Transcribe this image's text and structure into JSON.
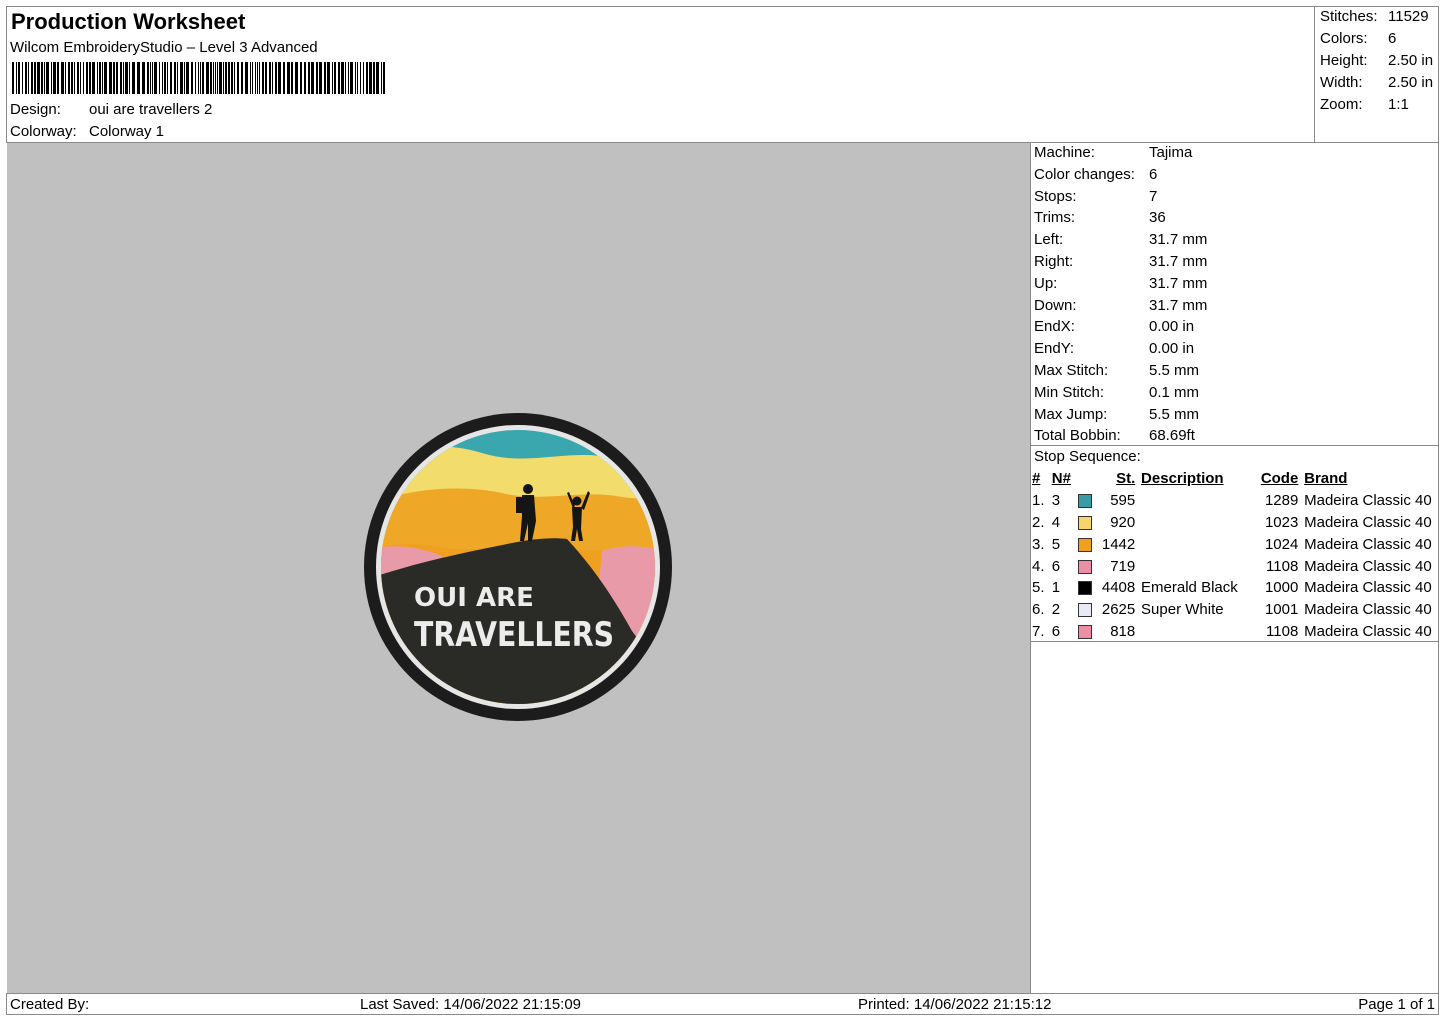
{
  "header": {
    "title": "Production Worksheet",
    "subtitle": "Wilcom EmbroideryStudio – Level 3 Advanced",
    "design_label": "Design:",
    "design_value": "oui are travellers 2",
    "colorway_label": "Colorway:",
    "colorway_value": "Colorway 1"
  },
  "summary": [
    {
      "label": "Stitches:",
      "value": "11529"
    },
    {
      "label": "Colors:",
      "value": "6"
    },
    {
      "label": "Height:",
      "value": "2.50 in"
    },
    {
      "label": "Width:",
      "value": "2.50 in"
    },
    {
      "label": "Zoom:",
      "value": "1:1"
    }
  ],
  "machine_info": [
    {
      "label": "Machine:",
      "value": "Tajima"
    },
    {
      "label": "Color changes:",
      "value": "6"
    },
    {
      "label": "Stops:",
      "value": "7"
    },
    {
      "label": "Trims:",
      "value": "36"
    },
    {
      "label": "Left:",
      "value": "31.7 mm"
    },
    {
      "label": "Right:",
      "value": "31.7 mm"
    },
    {
      "label": "Up:",
      "value": "31.7 mm"
    },
    {
      "label": "Down:",
      "value": "31.7 mm"
    },
    {
      "label": "EndX:",
      "value": "0.00 in"
    },
    {
      "label": "EndY:",
      "value": "0.00 in"
    },
    {
      "label": "Max Stitch:",
      "value": "5.5 mm"
    },
    {
      "label": "Min Stitch:",
      "value": "0.1 mm"
    },
    {
      "label": "Max Jump:",
      "value": "5.5 mm"
    },
    {
      "label": "Total Bobbin:",
      "value": "68.69ft"
    }
  ],
  "stop_sequence": {
    "title": "Stop Sequence:",
    "headers": {
      "num": "#",
      "needle": "N#",
      "st": "St.",
      "description": "Description",
      "code": "Code",
      "brand": "Brand"
    },
    "rows": [
      {
        "num": "1.",
        "needle": "3",
        "color": "#3a9aa6",
        "st": "595",
        "description": "",
        "code": "1289",
        "brand": "Madeira Classic 40"
      },
      {
        "num": "2.",
        "needle": "4",
        "color": "#f4d66a",
        "st": "920",
        "description": "",
        "code": "1023",
        "brand": "Madeira Classic 40"
      },
      {
        "num": "3.",
        "needle": "5",
        "color": "#f0a01e",
        "st": "1442",
        "description": "",
        "code": "1024",
        "brand": "Madeira Classic 40"
      },
      {
        "num": "4.",
        "needle": "6",
        "color": "#ea8fa4",
        "st": "719",
        "description": "",
        "code": "1108",
        "brand": "Madeira Classic 40"
      },
      {
        "num": "5.",
        "needle": "1",
        "color": "#000000",
        "st": "4408",
        "description": "Emerald Black",
        "code": "1000",
        "brand": "Madeira Classic 40"
      },
      {
        "num": "6.",
        "needle": "2",
        "color": "#e8eaf8",
        "st": "2625",
        "description": "Super White",
        "code": "1001",
        "brand": "Madeira Classic 40"
      },
      {
        "num": "7.",
        "needle": "6",
        "color": "#ea8fa4",
        "st": "818",
        "description": "",
        "code": "1108",
        "brand": "Madeira Classic 40"
      }
    ]
  },
  "patch": {
    "line1": "OUI ARE",
    "line2": "TRAVELLERS"
  },
  "footer": {
    "created_by": "Created By:",
    "last_saved": "Last Saved: 14/06/2022 21:15:09",
    "printed": "Printed: 14/06/2022 21:15:12",
    "page": "Page 1 of 1"
  }
}
